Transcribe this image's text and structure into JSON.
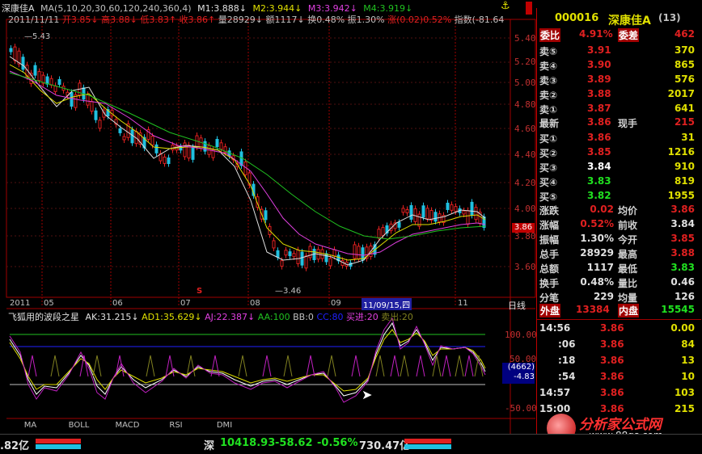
{
  "header": {
    "title": "深康佳A",
    "ma_label": "MA(5,10,20,30,60,120,240,360,4)",
    "m1": "M1:3.888↓",
    "m2": "M2:3.944↓",
    "m3": "M3:3.942↓",
    "m4": "M4:3.919↓",
    "lock_icon": "lock-icon"
  },
  "infobar": {
    "date": "2011/11/11",
    "open": "开3.85↓",
    "high": "高3.88↓",
    "low": "低3.83↑",
    "close": "收3.86↑",
    "volume": "量28929↓",
    "amount": "额1117↓",
    "turnover": "换0.48%",
    "amplitude": "振1.30%",
    "change": "涨(0.02)0.52%",
    "index": "指数(-81.64"
  },
  "chart": {
    "high_marker": "5.43",
    "low_marker": "3.46",
    "price_ticks": [
      "5.40",
      "5.20",
      "5.00",
      "4.80",
      "4.60",
      "4.40",
      "4.20",
      "4.00",
      "3.80",
      "3.60"
    ],
    "current_price": "3.86",
    "months": [
      "2011",
      "05",
      "06",
      "07",
      "08",
      "09",
      "11/09/15,四",
      "11"
    ],
    "s_marker": "S",
    "period": "日线"
  },
  "indicator": {
    "name": "飞狐用的波段之星",
    "ak": "AK:31.215↓",
    "ad1": "AD1:35.629↓",
    "aj": "AJ:22.387↓",
    "aa": "AA:100",
    "bb": "BB:0",
    "cc": "CC:80",
    "buy": "买进:20",
    "sell": "卖出:20",
    "ticks": [
      "100.00",
      "50.00",
      "-50.00"
    ],
    "cursor_box_top": "(4662)",
    "cursor_box_bottom": "-4.83"
  },
  "tabs": [
    "MA",
    "BOLL",
    "MACD",
    "RSI",
    "DMI"
  ],
  "quote": {
    "code": "000016",
    "name": "深康佳A",
    "count": "(13)",
    "weibi_label": "委比",
    "weibi_value": "4.91%",
    "weicha_label": "委差",
    "weicha_value": "462",
    "sells": [
      {
        "label": "卖⑤",
        "price": "3.91",
        "vol": "370"
      },
      {
        "label": "卖④",
        "price": "3.90",
        "vol": "865"
      },
      {
        "label": "卖③",
        "price": "3.89",
        "vol": "576"
      },
      {
        "label": "卖②",
        "price": "3.88",
        "vol": "2017"
      },
      {
        "label": "卖①",
        "price": "3.87",
        "vol": "641"
      }
    ],
    "latest_label": "最新",
    "latest_value": "3.86",
    "xianshou_label": "现手",
    "xianshou_value": "215",
    "buys": [
      {
        "label": "买①",
        "price": "3.86",
        "vol": "31"
      },
      {
        "label": "买②",
        "price": "3.85",
        "vol": "1216"
      },
      {
        "label": "买③",
        "price": "3.84",
        "vol": "910"
      },
      {
        "label": "买④",
        "price": "3.83",
        "vol": "819"
      },
      {
        "label": "买⑤",
        "price": "3.82",
        "vol": "1955"
      }
    ],
    "stats": [
      {
        "l1": "涨跌",
        "v1": "0.02",
        "l2": "均价",
        "v2": "3.86"
      },
      {
        "l1": "涨幅",
        "v1": "0.52%",
        "l2": "前收",
        "v2": "3.84"
      },
      {
        "l1": "振幅",
        "v1": "1.30%",
        "l2": "今开",
        "v2": "3.85"
      },
      {
        "l1": "总手",
        "v1": "28929",
        "l2": "最高",
        "v2": "3.88"
      },
      {
        "l1": "总额",
        "v1": "1117",
        "l2": "最低",
        "v2": "3.83"
      },
      {
        "l1": "换手",
        "v1": "0.48%",
        "l2": "量比",
        "v2": "0.46"
      },
      {
        "l1": "分笔",
        "v1": "229",
        "l2": "均量",
        "v2": "126"
      }
    ],
    "waipan_label": "外盘",
    "waipan_value": "13384",
    "neipan_label": "内盘",
    "neipan_value": "15545",
    "ticks": [
      {
        "t": "14:56",
        "p": "3.86",
        "v": "0.00"
      },
      {
        "t": ":06",
        "p": "3.86",
        "v": "84"
      },
      {
        "t": ":18",
        "p": "3.86",
        "v": "13"
      },
      {
        "t": ":54",
        "p": "3.86",
        "v": "10"
      },
      {
        "t": "14:57",
        "p": "3.86",
        "v": "103"
      },
      {
        "t": "15:00",
        "p": "3.86",
        "v": "215"
      }
    ]
  },
  "watermark": {
    "title": "分析家公式网",
    "url": "www.88gs.com"
  },
  "bottom": {
    "left_amount": ".82亿",
    "index_name": "深",
    "index_value": "10418.93",
    "index_change": "-58.62",
    "index_pct": "-0.56%",
    "index_amount": "730.47亿"
  }
}
